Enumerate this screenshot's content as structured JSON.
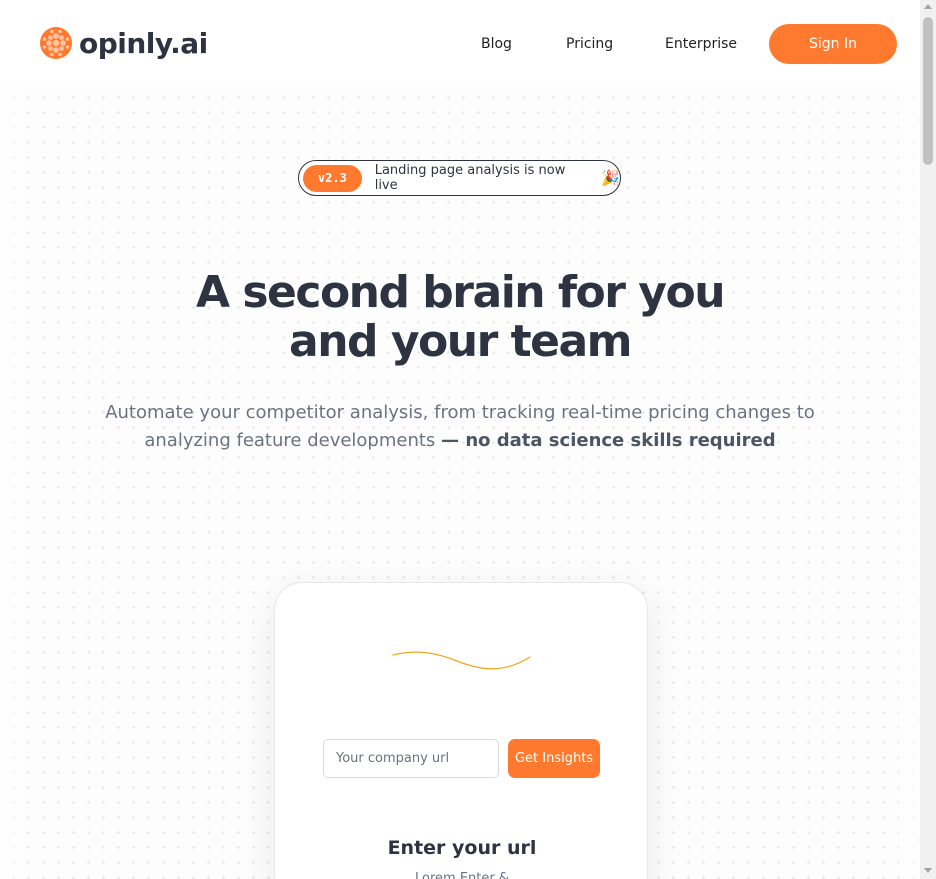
{
  "header": {
    "logo_text": "opinly.ai",
    "nav": {
      "blog": "Blog",
      "pricing": "Pricing",
      "enterprise": "Enterprise"
    },
    "signin_label": "Sign In"
  },
  "announcement": {
    "version": "v2.3",
    "text": "Landing page analysis is now live",
    "emoji": "🎉"
  },
  "hero": {
    "title_line1": "A second brain for you",
    "title_line2": "and your team",
    "subtitle": "Automate your competitor analysis, from tracking real-time pricing changes to analyzing feature developments",
    "subtitle_emphasis": "— no data science skills required"
  },
  "card": {
    "url_placeholder": "Your company url",
    "url_value": "",
    "cta_label": "Get Insights",
    "step_title": "Enter your url",
    "step_desc": "Lorem Enter &"
  },
  "colors": {
    "accent": "#ff7a2f",
    "text_dark": "#2d3340",
    "text_muted": "#6b7280"
  }
}
